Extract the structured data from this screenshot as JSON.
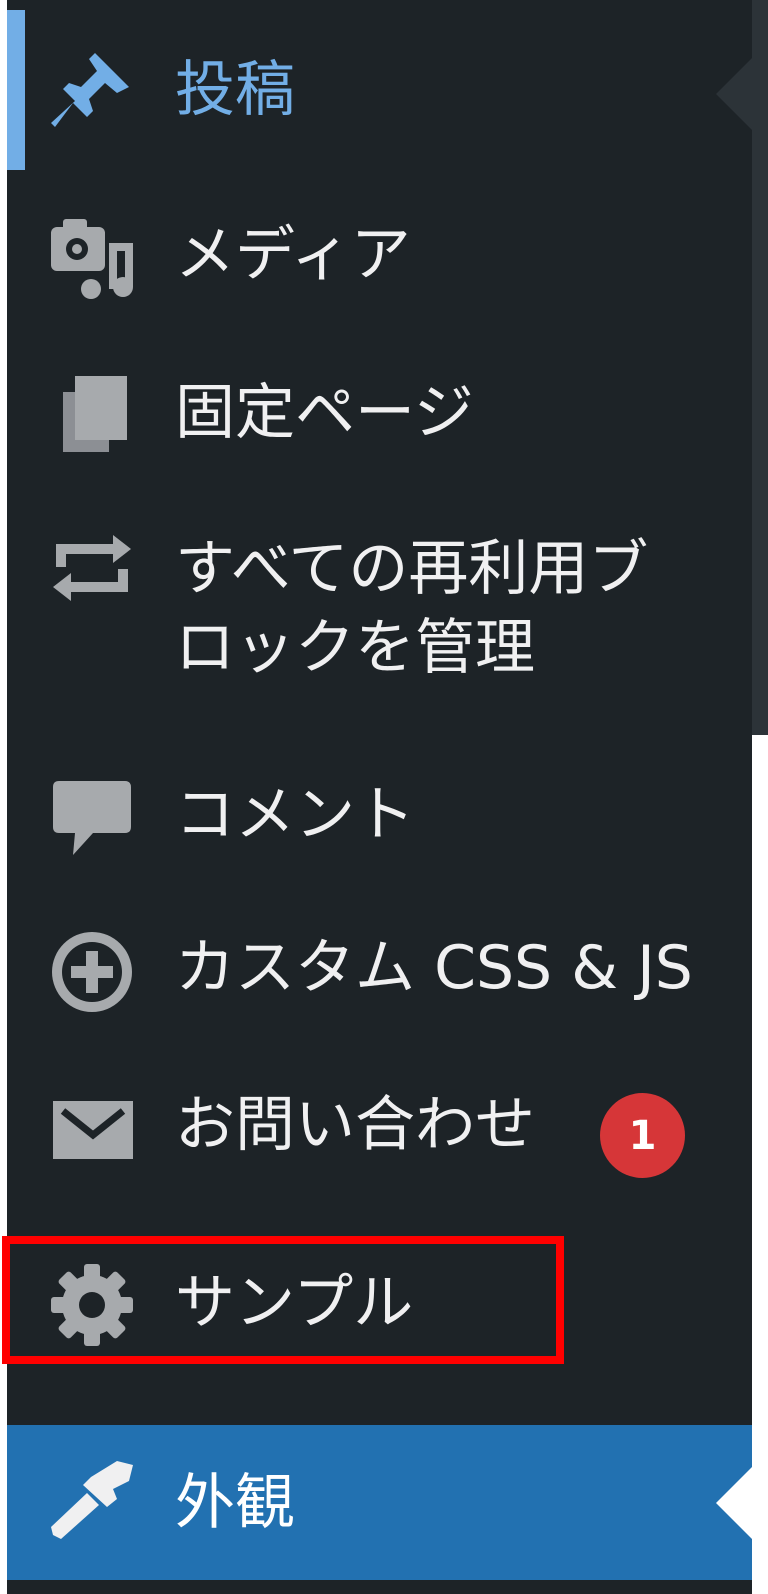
{
  "menu": {
    "posts": {
      "label": "投稿",
      "icon": "pin-icon"
    },
    "media": {
      "label": "メディア",
      "icon": "media-icon"
    },
    "pages": {
      "label": "固定ページ",
      "icon": "pages-icon"
    },
    "reusable_blocks": {
      "label_line1": "すべての再利用ブ",
      "label_line2": "ロックを管理",
      "icon": "reusable-block-icon"
    },
    "comments": {
      "label": "コメント",
      "icon": "comment-icon"
    },
    "custom_css_js": {
      "label": "カスタム CSS & JS",
      "icon": "plus-circle-icon"
    },
    "contact": {
      "label": "お問い合わせ",
      "badge": "1",
      "icon": "envelope-icon"
    },
    "sample": {
      "label": "サンプル",
      "icon": "gear-icon"
    },
    "appearance": {
      "label": "外観",
      "icon": "paintbrush-icon"
    }
  },
  "colors": {
    "menu_bg": "#1d2327",
    "menu_text": "#f0f0f1",
    "icon": "#a7aaad",
    "active_text": "#72aee6",
    "current_bg": "#2271b1",
    "badge_bg": "#d63638",
    "highlight": "#ff0000"
  }
}
